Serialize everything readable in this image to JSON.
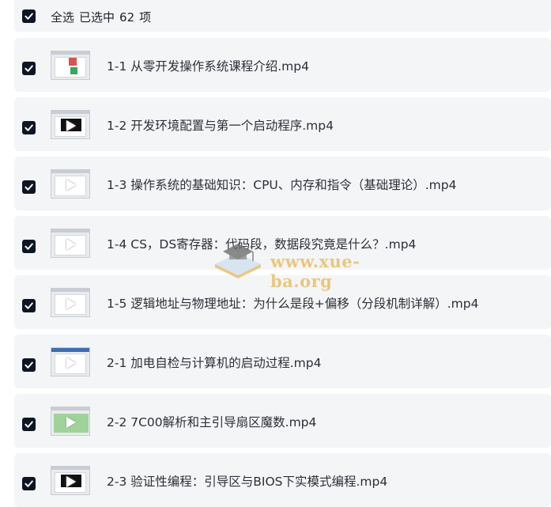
{
  "header": {
    "select_all": "全选",
    "selected_prefix": "已选中",
    "selected_count": "62",
    "selected_suffix": "项"
  },
  "files": [
    {
      "title": "1-1 从零开发操作系统课程介绍.mp4",
      "checked": true
    },
    {
      "title": "1-2 开发环境配置与第一个启动程序.mp4",
      "checked": true
    },
    {
      "title": "1-3 操作系统的基础知识：CPU、内存和指令（基础理论）.mp4",
      "checked": true
    },
    {
      "title": "1-4 CS，DS寄存器：代码段，数据段究竟是什么？.mp4",
      "checked": true
    },
    {
      "title": "1-5 逻辑地址与物理地址：为什么是段+偏移（分段机制详解）.mp4",
      "checked": true
    },
    {
      "title": "2-1 加电自检与计算机的启动过程.mp4",
      "checked": true
    },
    {
      "title": "2-2 7C00解析和主引导扇区魔数.mp4",
      "checked": true
    },
    {
      "title": "2-3 验证性编程：引导区与BIOS下实模式编程.mp4",
      "checked": true
    }
  ],
  "watermark": {
    "text": "www.xue-ba.org"
  },
  "colors": {
    "checkbox": "#0e1624",
    "row_bg": "#f4f5f7",
    "watermark": "#e8c06a"
  }
}
